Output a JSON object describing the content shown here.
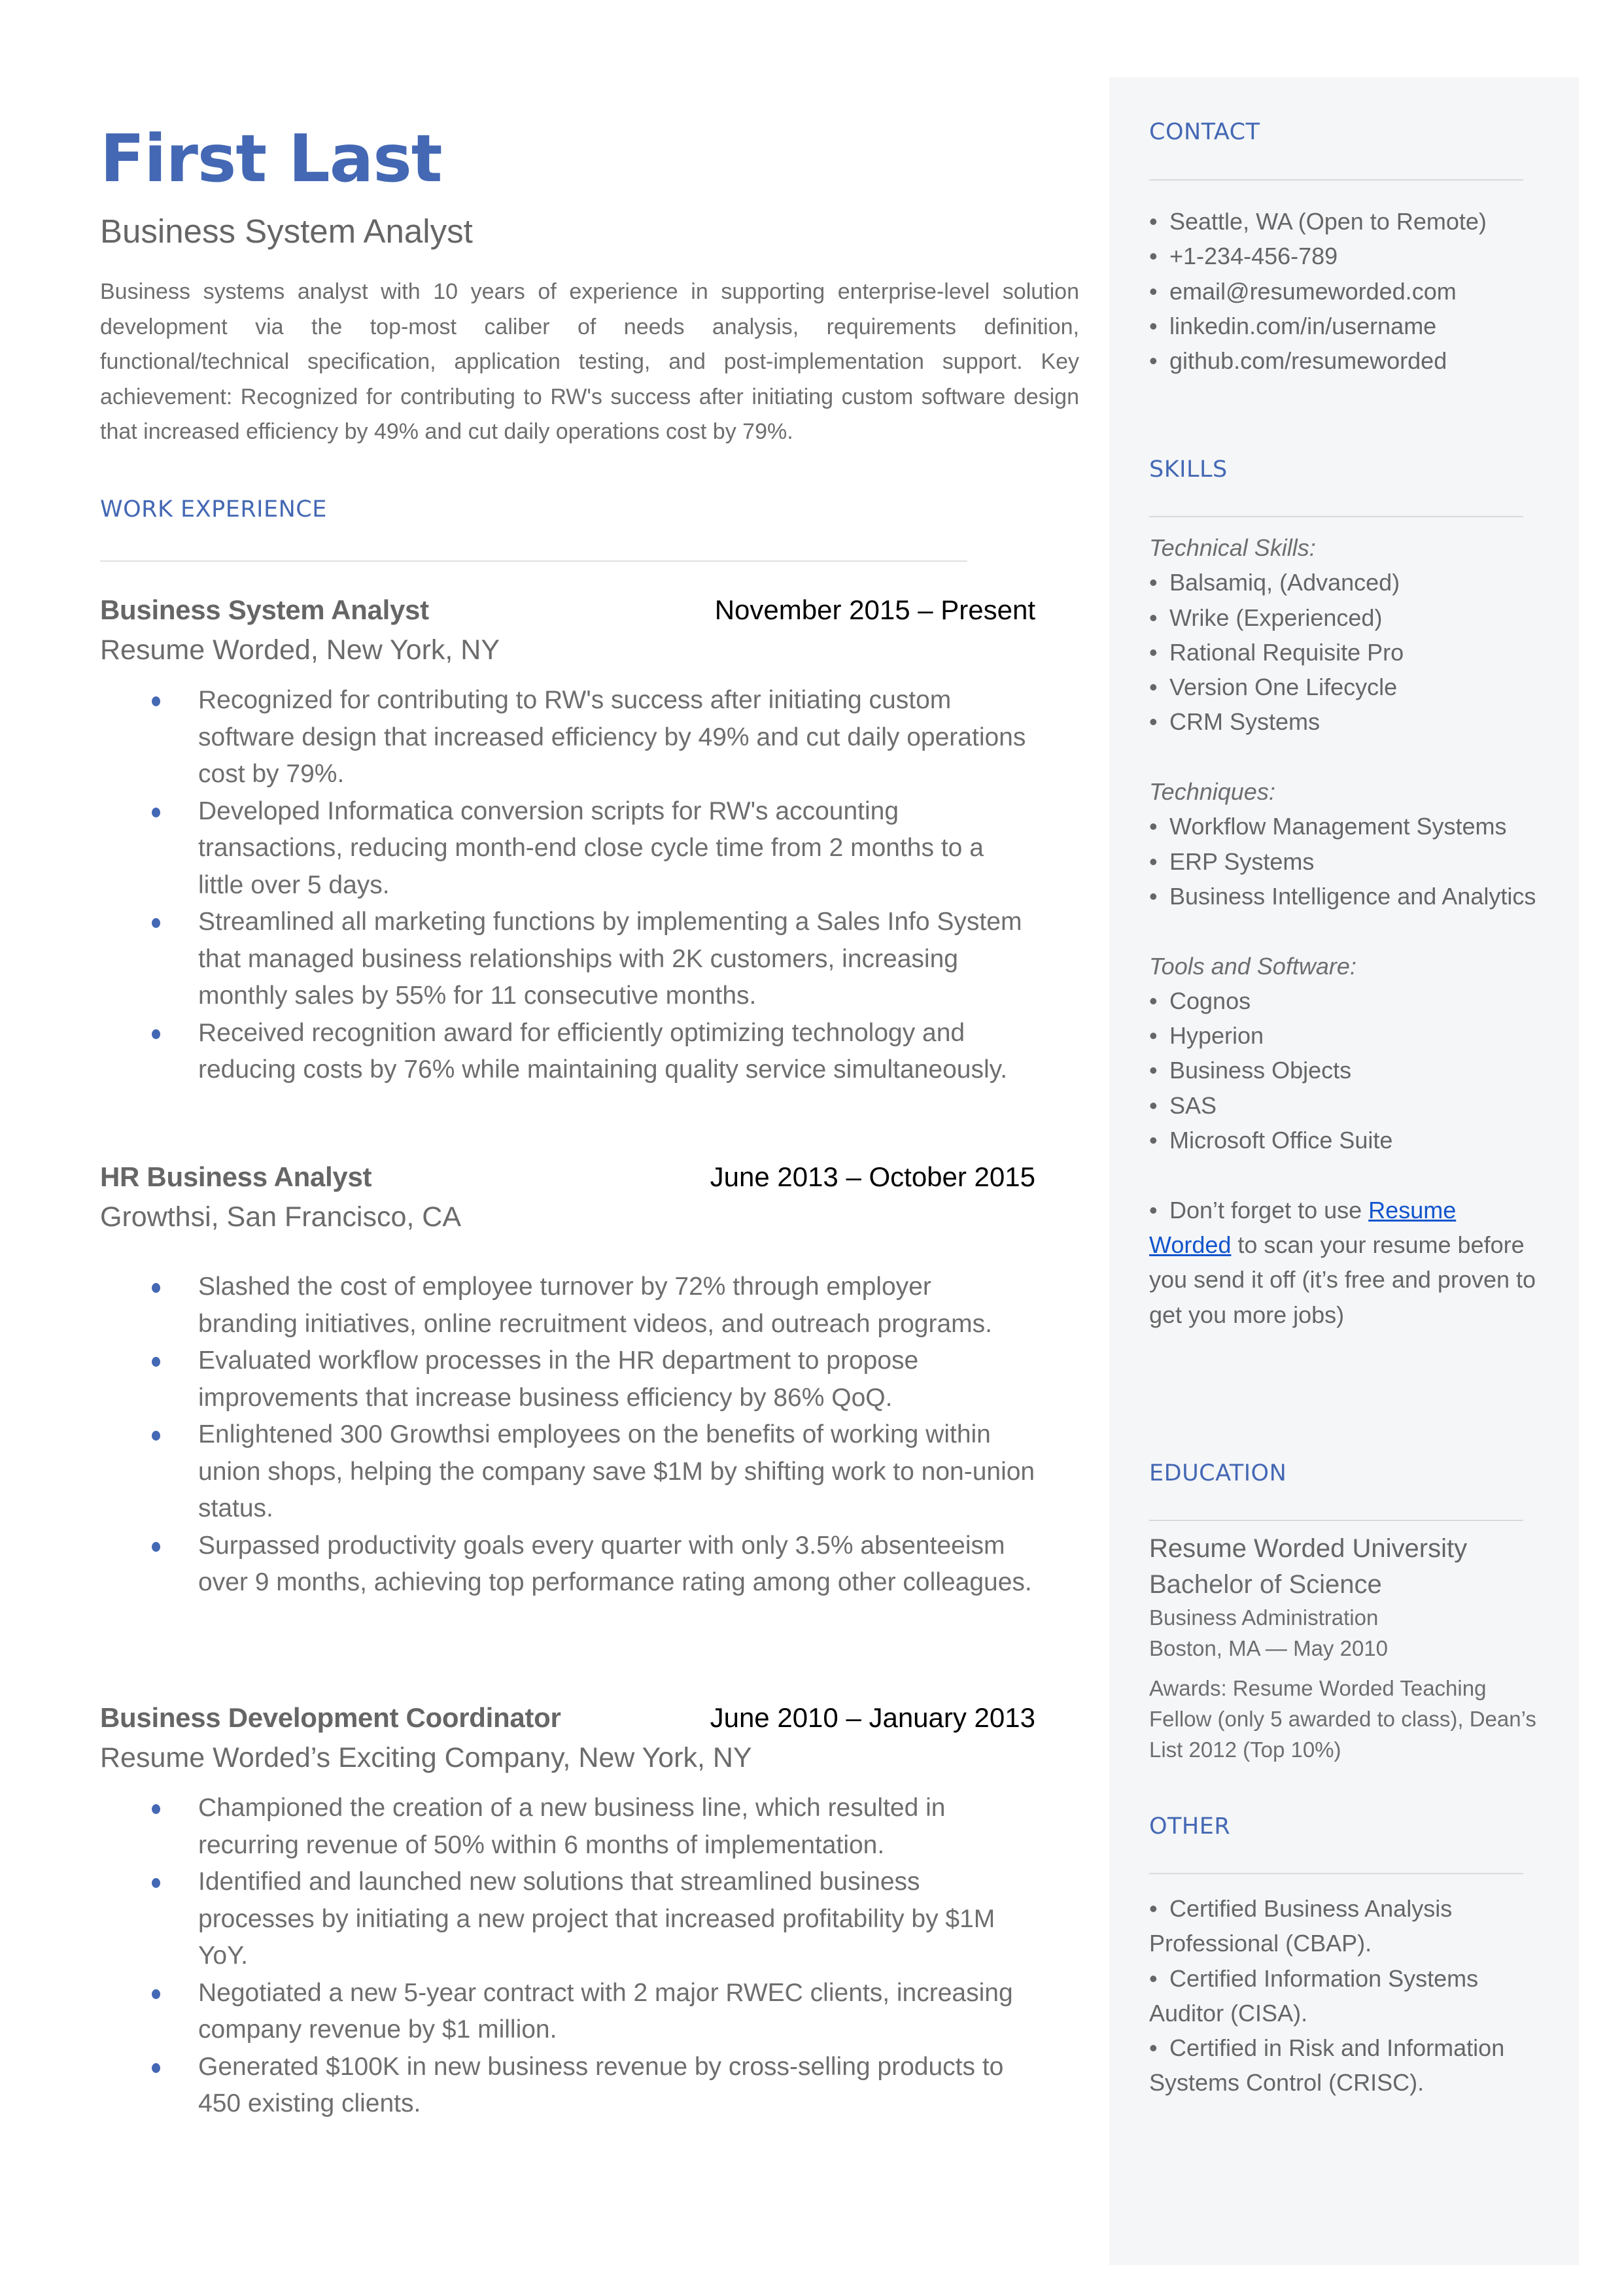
{
  "header": {
    "name": "First Last",
    "headline": "Business System Analyst",
    "summary": "Business systems analyst with 10 years of experience in supporting enterprise-level solution development via the top-most caliber of needs analysis, requirements definition, functional/technical specification,  application testing, and post-implementation support. Key achievement: Recognized for contributing to RW's success after initiating custom software design that increased efficiency by 49% and cut daily operations cost by 79%."
  },
  "work_experience": {
    "title": "WORK EXPERIENCE",
    "jobs": [
      {
        "title": "Business System Analyst",
        "dates": "November 2015 – Present",
        "company": "Resume Worded, New York, NY",
        "bullets": [
          "Recognized for contributing to RW's success after initiating custom software design that increased efficiency by 49% and cut daily operations cost by 79%.",
          "Developed Informatica conversion scripts for RW's accounting transactions, reducing month-end close cycle time from 2 months to a little over 5 days.",
          "Streamlined all marketing functions by implementing a Sales Info System that managed business relationships with 2K customers, increasing monthly sales by 55% for 11 consecutive months.",
          "Received recognition award for efficiently optimizing technology and reducing costs by 76% while maintaining quality service simultaneously."
        ]
      },
      {
        "title": "HR Business Analyst",
        "dates": "June 2013 – October 2015",
        "company": "Growthsi, San Francisco, CA",
        "bullets": [
          "Slashed the cost of employee turnover by 72% through employer branding initiatives, online recruitment videos, and outreach programs.",
          "Evaluated workflow processes in the HR department to propose improvements that increase business efficiency by 86% QoQ.",
          "Enlightened 300 Growthsi employees on the benefits of working within union shops, helping the company save $1M by shifting work to non-union status.",
          "Surpassed productivity goals every quarter with only 3.5% absenteeism over 9 months, achieving top performance rating among other colleagues."
        ]
      },
      {
        "title": "Business Development Coordinator",
        "dates": "June 2010 – January 2013",
        "company": "Resume Worded’s Exciting Company, New York, NY",
        "bullets": [
          "Championed the creation of a new business line, which resulted in recurring revenue of 50% within 6 months of implementation.",
          "Identified and launched new solutions that streamlined business processes by initiating a new project that increased profitability by $1M YoY.",
          "Negotiated a new 5-year contract with 2 major RWEC clients, increasing company revenue by $1 million.",
          "Generated $100K in new business revenue by cross-selling products to 450 existing clients."
        ]
      }
    ]
  },
  "sidebar": {
    "contact": {
      "title": "CONTACT",
      "items": [
        "Seattle, WA (Open to Remote)",
        "+1-234-456-789",
        "email@resumeworded.com",
        "linkedin.com/in/username",
        "github.com/resumeworded"
      ]
    },
    "skills": {
      "title": "SKILLS",
      "groups": [
        {
          "label": "Technical Skills:",
          "items": [
            "Balsamiq, (Advanced)",
            "Wrike (Experienced)",
            "Rational Requisite Pro",
            "Version One Lifecycle",
            "CRM Systems"
          ]
        },
        {
          "label": "Techniques:",
          "items": [
            "Workflow Management Systems",
            "ERP Systems",
            "Business Intelligence and Analytics"
          ]
        },
        {
          "label": "Tools and Software:",
          "items": [
            "Cognos",
            "Hyperion",
            "Business Objects",
            "SAS",
            "Microsoft Office Suite"
          ]
        }
      ],
      "tip": {
        "before": "Don’t forget to use ",
        "link_text": "Resume Worded",
        "after": " to scan your resume before you send it off (it’s free and proven to get you more jobs)"
      }
    },
    "education": {
      "title": "EDUCATION",
      "school": "Resume Worded University",
      "degree": "Bachelor of Science",
      "field": "Business Administration",
      "location_date": "Boston, MA — May 2010",
      "awards": "Awards: Resume Worded Teaching Fellow (only 5 awarded to class), Dean’s List 2012 (Top 10%)"
    },
    "other": {
      "title": "OTHER",
      "items": [
        "Certified Business Analysis Professional (CBAP).",
        "Certified Information Systems Auditor (CISA).",
        "Certified in Risk and Information Systems Control (CRISC)."
      ]
    }
  },
  "colors": {
    "accent": "#4468b4",
    "sidebar_bg": "#f5f6f8",
    "body_text": "#666666",
    "link": "#1155cc"
  }
}
